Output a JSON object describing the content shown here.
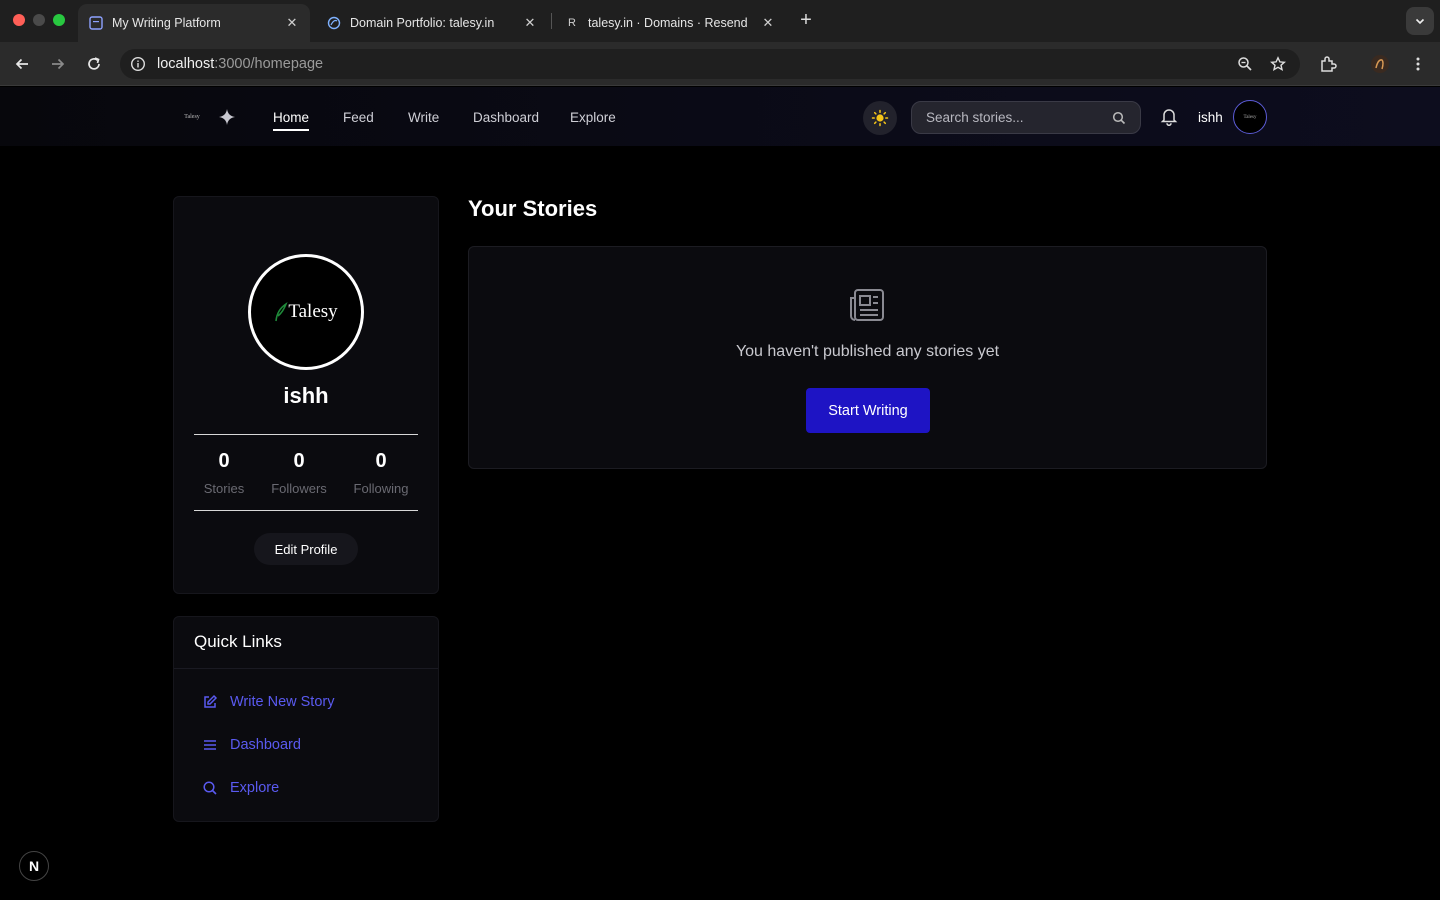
{
  "browser": {
    "tabs": [
      {
        "title": "My Writing Platform",
        "active": true,
        "favicon": "site-favicon-icon"
      },
      {
        "title": "Domain Portfolio: talesy.in",
        "active": false,
        "favicon": "domain-favicon-icon"
      },
      {
        "title": "talesy.in · Domains · Resend",
        "active": false,
        "favicon_text": "R"
      }
    ],
    "url_host": "localhost",
    "url_path": ":3000/homepage"
  },
  "header": {
    "logo_text": "Talesy",
    "nav": [
      "Home",
      "Feed",
      "Write",
      "Dashboard",
      "Explore"
    ],
    "active_nav": "Home",
    "search_placeholder": "Search stories...",
    "username": "ishh",
    "avatar_text": "Talesy"
  },
  "profile": {
    "avatar_brand": "Talesy",
    "name": "ishh",
    "stats": [
      {
        "value": "0",
        "label": "Stories"
      },
      {
        "value": "0",
        "label": "Followers"
      },
      {
        "value": "0",
        "label": "Following"
      }
    ],
    "edit_label": "Edit Profile"
  },
  "quick_links": {
    "title": "Quick Links",
    "items": [
      {
        "label": "Write New Story",
        "icon": "edit-icon"
      },
      {
        "label": "Dashboard",
        "icon": "list-icon"
      },
      {
        "label": "Explore",
        "icon": "search-icon"
      }
    ]
  },
  "stories": {
    "title": "Your Stories",
    "empty_message": "You haven't published any stories yet",
    "cta_label": "Start Writing"
  },
  "dev_badge": "N",
  "colors": {
    "accent": "#1e14c4",
    "link": "#5a5af0",
    "background": "#000000",
    "card": "#0b0b0f"
  }
}
